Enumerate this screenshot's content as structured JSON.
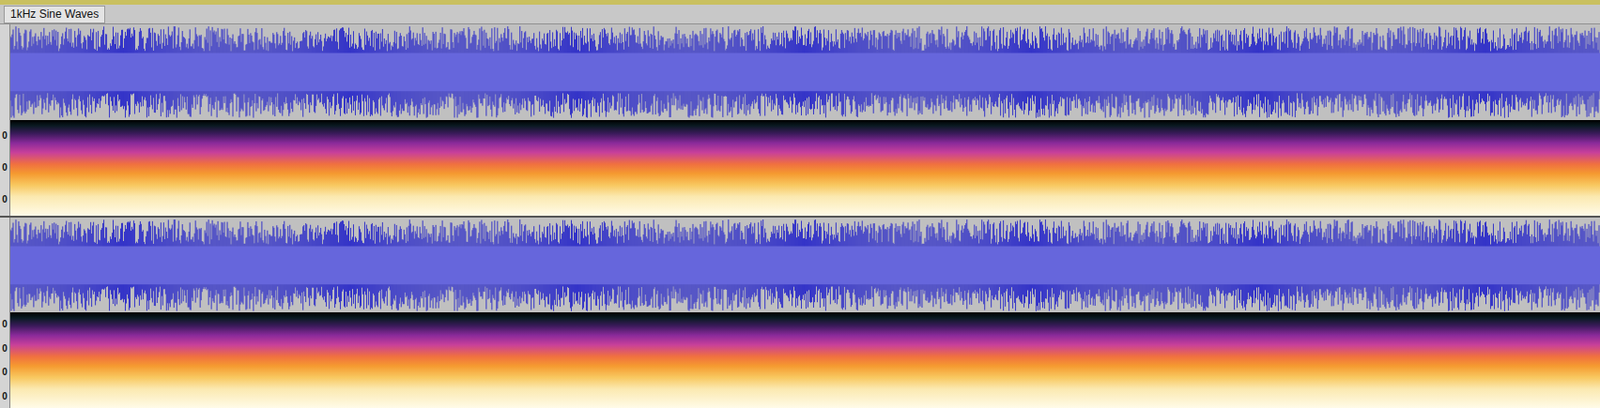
{
  "track": {
    "name": "1kHz Sine Waves"
  },
  "channels": [
    {
      "waveform_labels": [],
      "spectrogram_labels": [
        "0",
        "0",
        "0"
      ]
    },
    {
      "waveform_labels": [],
      "spectrogram_labels": [
        "0",
        "0",
        "0",
        "0"
      ]
    }
  ]
}
